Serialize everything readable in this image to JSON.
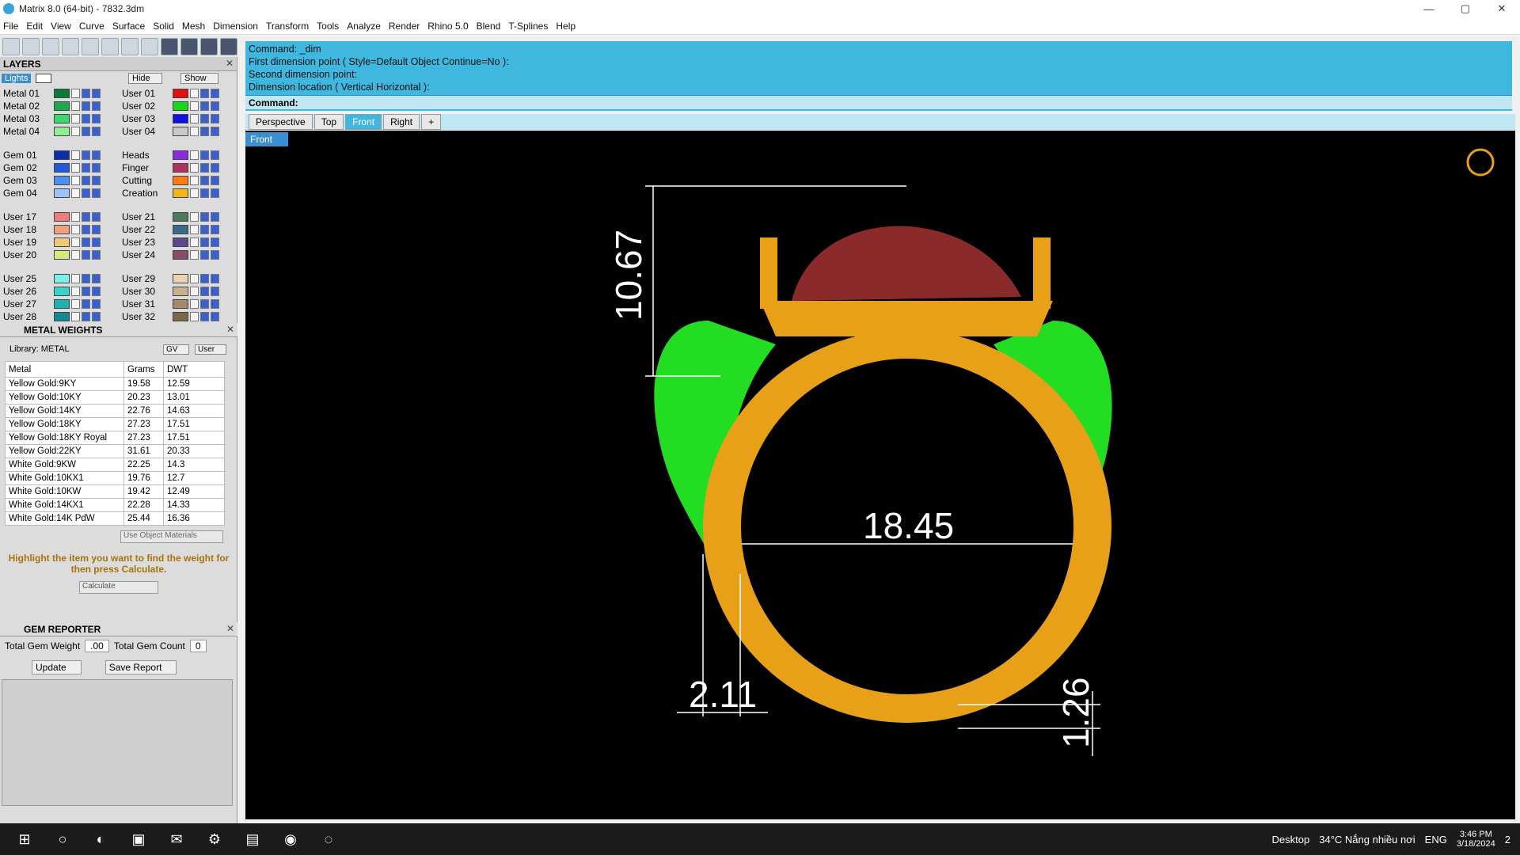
{
  "window": {
    "title": "Matrix 8.0 (64-bit) - 7832.3dm",
    "min": "—",
    "max": "▢",
    "close": "✕"
  },
  "menu": [
    "File",
    "Edit",
    "View",
    "Curve",
    "Surface",
    "Solid",
    "Mesh",
    "Dimension",
    "Transform",
    "Tools",
    "Analyze",
    "Render",
    "Rhino 5.0",
    "Blend",
    "T-Splines",
    "Help"
  ],
  "layers": {
    "title": "LAYERS",
    "lights": "Lights",
    "hide": "Hide",
    "show": "Show",
    "left": [
      {
        "name": "Metal 01",
        "color": "#0a7a3a"
      },
      {
        "name": "Metal 02",
        "color": "#1aa850"
      },
      {
        "name": "Metal 03",
        "color": "#39d86a"
      },
      {
        "name": "Metal 04",
        "color": "#8ef08e"
      },
      {
        "name": "Gem 01",
        "color": "#0a2fa8"
      },
      {
        "name": "Gem 02",
        "color": "#1f57e0"
      },
      {
        "name": "Gem 03",
        "color": "#4a8ff2"
      },
      {
        "name": "Gem 04",
        "color": "#9cc4fb"
      },
      {
        "name": "User 17",
        "color": "#f17a7a"
      },
      {
        "name": "User 18",
        "color": "#f1a27a"
      },
      {
        "name": "User 19",
        "color": "#f1c77a"
      },
      {
        "name": "User 20",
        "color": "#d9e87a"
      },
      {
        "name": "User 25",
        "color": "#7af1e8"
      },
      {
        "name": "User 26",
        "color": "#33d6c8"
      },
      {
        "name": "User 27",
        "color": "#1ab2b2"
      },
      {
        "name": "User 28",
        "color": "#138a92"
      }
    ],
    "right": [
      {
        "name": "User 01",
        "color": "#e01010"
      },
      {
        "name": "User 02",
        "color": "#18d818"
      },
      {
        "name": "User 03",
        "color": "#1010e0"
      },
      {
        "name": "User 04",
        "color": "#c8c8c8"
      },
      {
        "name": "Heads",
        "color": "#8a2be2"
      },
      {
        "name": "Finger",
        "color": "#b03060"
      },
      {
        "name": "Cutting",
        "color": "#ff7a10"
      },
      {
        "name": "Creation",
        "color": "#f2b61a"
      },
      {
        "name": "User 21",
        "color": "#4a7a5a"
      },
      {
        "name": "User 22",
        "color": "#3a6a8a"
      },
      {
        "name": "User 23",
        "color": "#5a4a8a"
      },
      {
        "name": "User 24",
        "color": "#8a4a6a"
      },
      {
        "name": "User 29",
        "color": "#e8d4b0"
      },
      {
        "name": "User 30",
        "color": "#c8b090"
      },
      {
        "name": "User 31",
        "color": "#a88a6a"
      },
      {
        "name": "User 32",
        "color": "#7a6a4a"
      }
    ]
  },
  "metal_weights": {
    "title": "METAL WEIGHTS",
    "library": "Library: METAL",
    "gv": "GV",
    "user": "User",
    "headers": [
      "Metal",
      "Grams",
      "DWT"
    ],
    "rows": [
      [
        "Yellow Gold:9KY",
        "19.58",
        "12.59"
      ],
      [
        "Yellow Gold:10KY",
        "20.23",
        "13.01"
      ],
      [
        "Yellow Gold:14KY",
        "22.76",
        "14.63"
      ],
      [
        "Yellow Gold:18KY",
        "27.23",
        "17.51"
      ],
      [
        "Yellow Gold:18KY Royal",
        "27.23",
        "17.51"
      ],
      [
        "Yellow Gold:22KY",
        "31.61",
        "20.33"
      ],
      [
        "White Gold:9KW",
        "22.25",
        "14.3"
      ],
      [
        "White Gold:10KX1",
        "19.76",
        "12.7"
      ],
      [
        "White Gold:10KW",
        "19.42",
        "12.49"
      ],
      [
        "White Gold:14KX1",
        "22.28",
        "14.33"
      ],
      [
        "White Gold:14K PdW",
        "25.44",
        "16.36"
      ]
    ],
    "use_object_materials": "Use Object Materials",
    "hint": "Highlight the item you want to find the weight for then press Calculate.",
    "calculate": "Calculate"
  },
  "gem_reporter": {
    "title": "GEM REPORTER",
    "total_weight_label": "Total Gem Weight",
    "total_weight": ".00",
    "total_count_label": "Total Gem Count",
    "total_count": "0",
    "update": "Update",
    "save_report": "Save Report"
  },
  "command": {
    "history": [
      "Command: _dim",
      "First dimension point ( Style=Default  Object  Continue=No ):",
      "Second dimension point:",
      "Dimension location ( Vertical  Horizontal ):"
    ],
    "prompt": "Command:"
  },
  "viewtabs": [
    "Perspective",
    "Top",
    "Front",
    "Right",
    "+"
  ],
  "active_tab": "Front",
  "viewport_label": "Front",
  "dimensions": {
    "height": "10.67",
    "inner_diameter": "18.45",
    "shank_width": "2.11",
    "thickness": "1.26"
  },
  "taskbar": {
    "desktop": "Desktop",
    "weather": "34°C  Nắng nhiều nơi",
    "lang": "ENG",
    "time": "3:46 PM",
    "date": "3/18/2024",
    "notif": "2"
  },
  "colors": {
    "cmd_bg": "#3fb7de",
    "gold": "#e8a018",
    "gem": "#8a2a2a",
    "prongs_green": "#22dd22"
  }
}
